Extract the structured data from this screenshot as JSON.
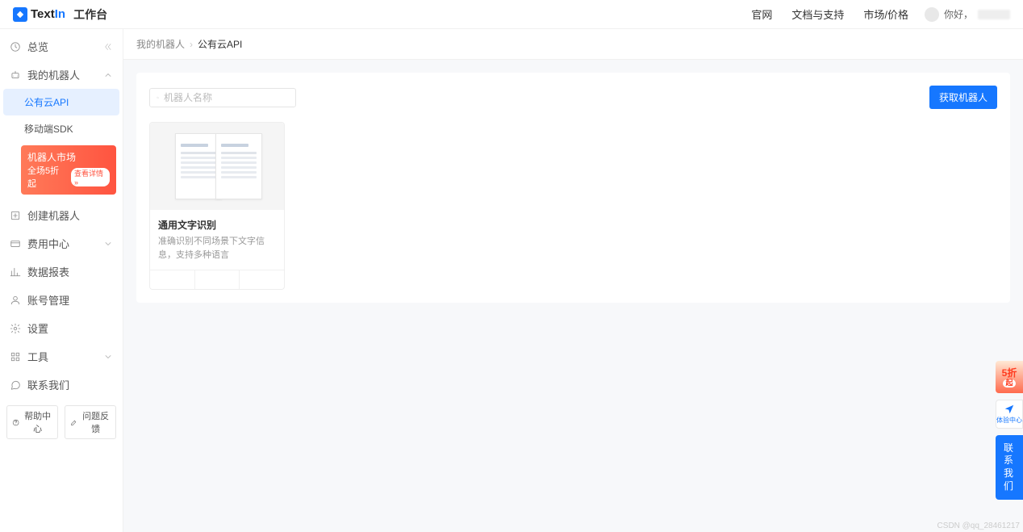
{
  "brand": {
    "name_prefix": "Text",
    "name_accent": "In"
  },
  "header": {
    "workspace": "工作台",
    "nav": {
      "official": "官网",
      "docs": "文档与支持",
      "market": "市场/价格"
    },
    "greeting": "你好，"
  },
  "sidebar": {
    "overview": "总览",
    "my_robots": "我的机器人",
    "sub_public_api": "公有云API",
    "sub_mobile_sdk": "移动端SDK",
    "promo": {
      "title": "机器人市场",
      "sub": "全场5折起",
      "pill": "查看详情 »"
    },
    "create_robot": "创建机器人",
    "billing": "费用中心",
    "reports": "数据报表",
    "account": "账号管理",
    "settings": "设置",
    "tools": "工具",
    "contact": "联系我们",
    "help_center": "帮助中心",
    "feedback": "问题反馈"
  },
  "breadcrumb": {
    "root": "我的机器人",
    "current": "公有云API"
  },
  "toolbar": {
    "search_placeholder": "机器人名称",
    "acquire_btn": "获取机器人"
  },
  "card": {
    "title": "通用文字识别",
    "desc": "准确识别不同场景下文字信息，支持多种语言"
  },
  "float": {
    "discount": "5折",
    "discount_sub": "起",
    "experience": "体验中心",
    "contact": "联系我们"
  },
  "watermark": "CSDN @qq_28461217"
}
